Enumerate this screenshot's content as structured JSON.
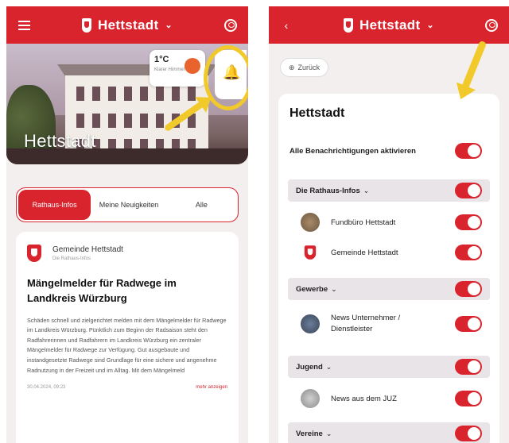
{
  "left_screen": {
    "topbar": {
      "title": "Hettstadt",
      "menu_icon": "hamburger-icon",
      "account_icon": "account-icon"
    },
    "hero": {
      "title": "Hettstadt",
      "weather_temp": "1°C",
      "weather_sub": "Klarer Himmel"
    },
    "segments": [
      {
        "label": "Rathaus-Infos",
        "active": true
      },
      {
        "label": "Meine Neuigkeiten",
        "active": false
      },
      {
        "label": "Alle",
        "active": false
      }
    ],
    "news": {
      "source": "Gemeinde Hettstadt",
      "source_sub": "Die Rathaus-Infos",
      "title": "Mängelmelder für Radwege im Landkreis Würzburg",
      "body": "Schäden schnell und zielgerichtet melden mit dem Mängelmelder für Radwege im Landkreis Würzburg. Pünktlich zum Beginn der Radsaison steht den Radfahrerinnen und Radfahrern im Landkreis Würzburg ein zentraler Mängelmelder für Radwege zur Verfügung. Gut ausgebaute und instandgesetzte Radwege sind Grundlage für eine sichere und angenehme Radnutzung in der Freizeit und im Alltag. Mit dem Mängelmeld",
      "date": "30.04.2024, 09:23",
      "more": "mehr anzeigen"
    }
  },
  "right_screen": {
    "topbar": {
      "title": "Hettstadt",
      "back_icon": "chevron-left-icon",
      "account_icon": "account-icon"
    },
    "back_label": "Zurück",
    "panel_title": "Hettstadt",
    "master_toggle": {
      "label": "Alle Benachrichtigungen aktivieren",
      "on": true
    },
    "groups": [
      {
        "label": "Die Rathaus-Infos",
        "on": true,
        "items": [
          {
            "label": "Fundbüro Hettstadt",
            "on": true
          },
          {
            "label": "Gemeinde Hettstadt",
            "on": true
          }
        ]
      },
      {
        "label": "Gewerbe",
        "on": true,
        "items": [
          {
            "label": "News Unternehmer / Dienstleister",
            "on": true
          }
        ]
      },
      {
        "label": "Jugend",
        "on": true,
        "items": [
          {
            "label": "News aus dem JUZ",
            "on": true
          }
        ]
      },
      {
        "label": "Vereine",
        "on": true,
        "items": []
      }
    ]
  },
  "colors": {
    "brand_red": "#d9232d",
    "highlight_yellow": "#f2c92a"
  }
}
